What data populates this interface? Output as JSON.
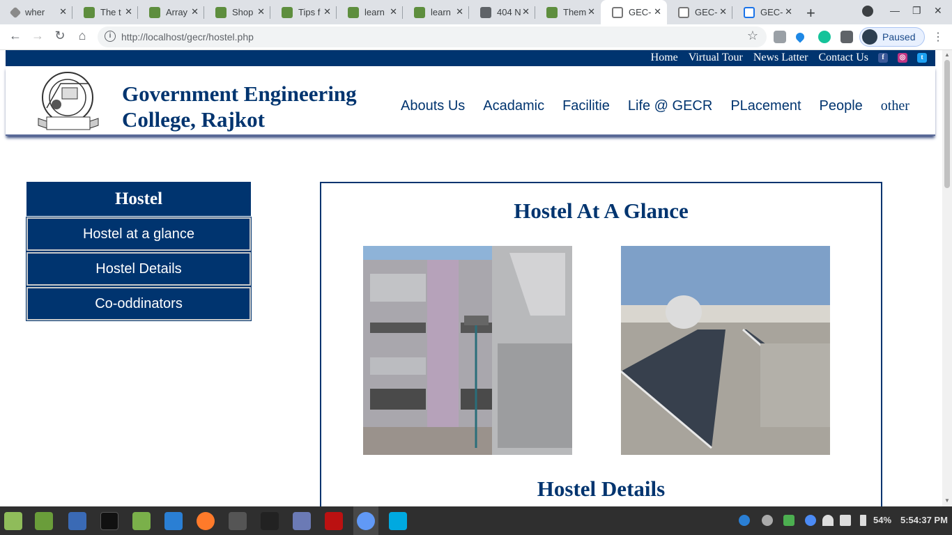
{
  "browser": {
    "tabs": [
      {
        "title": "wher",
        "icon": "drop-icon"
      },
      {
        "title": "The t",
        "icon": "shopify-icon"
      },
      {
        "title": "Array",
        "icon": "shopify-icon"
      },
      {
        "title": "Shop",
        "icon": "shopify-icon"
      },
      {
        "title": "Tips f",
        "icon": "shopify-icon"
      },
      {
        "title": "learn",
        "icon": "shopify-icon"
      },
      {
        "title": "learn",
        "icon": "shopify-icon"
      },
      {
        "title": "404 N",
        "icon": "globe-icon"
      },
      {
        "title": "Them",
        "icon": "shopify-icon"
      },
      {
        "title": "GEC-",
        "icon": "gec-icon"
      },
      {
        "title": "GEC-",
        "icon": "gec-icon"
      },
      {
        "title": "GEC-",
        "icon": "gec-icon"
      }
    ],
    "active_tab_index": 9,
    "url_host": "http://localhost",
    "url_path": "/gecr/hostel.php",
    "profile_status": "Paused"
  },
  "site": {
    "top_links": [
      "Home",
      "Virtual Tour",
      "News Latter",
      "Contact Us"
    ],
    "social": [
      "facebook-icon",
      "instagram-icon",
      "twitter-icon"
    ],
    "logo_text": "GOVERNMENT ENGINEERING COLLEGE RAJKOT",
    "logo_established": "Established in 2004",
    "college_name": "Government Engineering College, Rajkot",
    "nav": [
      "Abouts Us",
      "Acadamic",
      "Facilitie",
      "Life @ GECR",
      "PLacement",
      "People",
      "other"
    ]
  },
  "sidebar": {
    "title": "Hostel",
    "items": [
      "Hostel at a glance",
      "Hostel Details",
      "Co-oddinators"
    ]
  },
  "content": {
    "heading": "Hostel At A Glance",
    "subheading": "Hostel Details"
  },
  "taskbar": {
    "battery": "54%",
    "time": "5:54:37 PM"
  },
  "colors": {
    "brand": "#00346f",
    "chrome_tab_bg": "#dee1e6"
  }
}
